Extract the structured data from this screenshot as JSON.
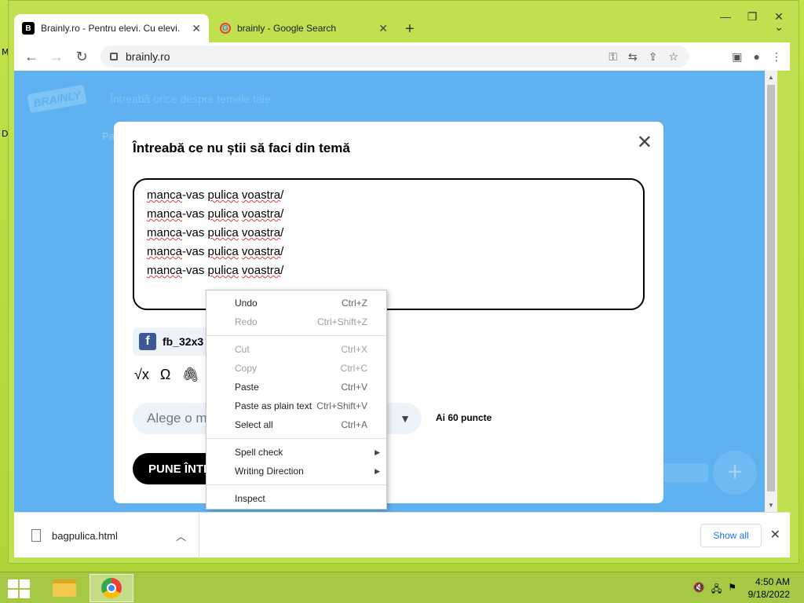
{
  "browser": {
    "tabs": [
      {
        "title": "Brainly.ro - Pentru elevi. Cu elevi.",
        "favicon": "B"
      },
      {
        "title": "brainly - Google Search",
        "favicon": "G"
      }
    ],
    "url": "brainly.ro"
  },
  "background": {
    "search_placeholder": "Întreabă orice despre temele tale",
    "fragment": "Pa"
  },
  "modal": {
    "title": "Întreabă ce nu știi să faci din temă",
    "lines": [
      [
        "manca",
        "-vas ",
        "pulica",
        " ",
        "voastra",
        "/"
      ],
      [
        "manca",
        "-vas ",
        "pulica",
        " ",
        "voastra",
        "/"
      ],
      [
        "manca",
        "-vas ",
        "pulica",
        " ",
        "voastra",
        "/"
      ],
      [
        "manca",
        "-vas ",
        "pulica",
        " ",
        "voastra",
        "/"
      ],
      [
        "manca",
        "-vas ",
        "pulica",
        " ",
        "voastra",
        "/"
      ]
    ],
    "attachment": "fb_32x3",
    "subject_placeholder": "Alege o ma",
    "points": "Ai 60 puncte",
    "submit": "PUNE ÎNTR"
  },
  "context_menu": {
    "groups": [
      [
        {
          "label": "Undo",
          "shortcut": "Ctrl+Z",
          "disabled": false
        },
        {
          "label": "Redo",
          "shortcut": "Ctrl+Shift+Z",
          "disabled": true
        }
      ],
      [
        {
          "label": "Cut",
          "shortcut": "Ctrl+X",
          "disabled": true
        },
        {
          "label": "Copy",
          "shortcut": "Ctrl+C",
          "disabled": true
        },
        {
          "label": "Paste",
          "shortcut": "Ctrl+V",
          "disabled": false
        },
        {
          "label": "Paste as plain text",
          "shortcut": "Ctrl+Shift+V",
          "disabled": false
        },
        {
          "label": "Select all",
          "shortcut": "Ctrl+A",
          "disabled": false
        }
      ],
      [
        {
          "label": "Spell check",
          "submenu": true
        },
        {
          "label": "Writing Direction",
          "submenu": true
        }
      ],
      [
        {
          "label": "Inspect"
        }
      ]
    ]
  },
  "download_bar": {
    "file": "bagpulica.html",
    "show_all": "Show all"
  },
  "taskbar": {
    "time": "4:50 AM",
    "date": "9/18/2022"
  },
  "desktop": {
    "fragments": [
      "M",
      "D"
    ]
  },
  "colors": {
    "brainly_blue": "#5fb1f0",
    "desktop_green": "#bfe04f",
    "link_blue": "#1a73e8"
  }
}
